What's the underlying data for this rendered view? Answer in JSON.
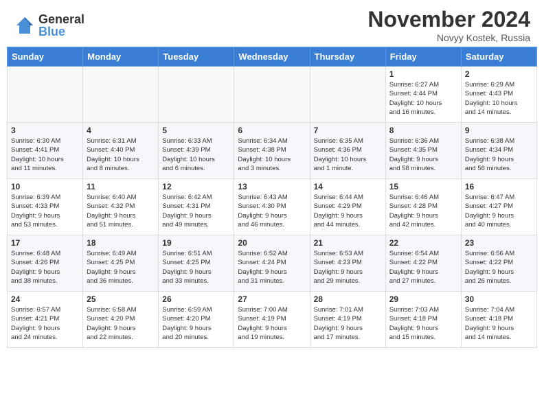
{
  "header": {
    "logo_general": "General",
    "logo_blue": "Blue",
    "month_title": "November 2024",
    "location": "Novyy Kostek, Russia"
  },
  "columns": [
    "Sunday",
    "Monday",
    "Tuesday",
    "Wednesday",
    "Thursday",
    "Friday",
    "Saturday"
  ],
  "weeks": [
    {
      "days": [
        {
          "num": "",
          "info": ""
        },
        {
          "num": "",
          "info": ""
        },
        {
          "num": "",
          "info": ""
        },
        {
          "num": "",
          "info": ""
        },
        {
          "num": "",
          "info": ""
        },
        {
          "num": "1",
          "info": "Sunrise: 6:27 AM\nSunset: 4:44 PM\nDaylight: 10 hours\nand 16 minutes."
        },
        {
          "num": "2",
          "info": "Sunrise: 6:29 AM\nSunset: 4:43 PM\nDaylight: 10 hours\nand 14 minutes."
        }
      ]
    },
    {
      "days": [
        {
          "num": "3",
          "info": "Sunrise: 6:30 AM\nSunset: 4:41 PM\nDaylight: 10 hours\nand 11 minutes."
        },
        {
          "num": "4",
          "info": "Sunrise: 6:31 AM\nSunset: 4:40 PM\nDaylight: 10 hours\nand 8 minutes."
        },
        {
          "num": "5",
          "info": "Sunrise: 6:33 AM\nSunset: 4:39 PM\nDaylight: 10 hours\nand 6 minutes."
        },
        {
          "num": "6",
          "info": "Sunrise: 6:34 AM\nSunset: 4:38 PM\nDaylight: 10 hours\nand 3 minutes."
        },
        {
          "num": "7",
          "info": "Sunrise: 6:35 AM\nSunset: 4:36 PM\nDaylight: 10 hours\nand 1 minute."
        },
        {
          "num": "8",
          "info": "Sunrise: 6:36 AM\nSunset: 4:35 PM\nDaylight: 9 hours\nand 58 minutes."
        },
        {
          "num": "9",
          "info": "Sunrise: 6:38 AM\nSunset: 4:34 PM\nDaylight: 9 hours\nand 56 minutes."
        }
      ]
    },
    {
      "days": [
        {
          "num": "10",
          "info": "Sunrise: 6:39 AM\nSunset: 4:33 PM\nDaylight: 9 hours\nand 53 minutes."
        },
        {
          "num": "11",
          "info": "Sunrise: 6:40 AM\nSunset: 4:32 PM\nDaylight: 9 hours\nand 51 minutes."
        },
        {
          "num": "12",
          "info": "Sunrise: 6:42 AM\nSunset: 4:31 PM\nDaylight: 9 hours\nand 49 minutes."
        },
        {
          "num": "13",
          "info": "Sunrise: 6:43 AM\nSunset: 4:30 PM\nDaylight: 9 hours\nand 46 minutes."
        },
        {
          "num": "14",
          "info": "Sunrise: 6:44 AM\nSunset: 4:29 PM\nDaylight: 9 hours\nand 44 minutes."
        },
        {
          "num": "15",
          "info": "Sunrise: 6:46 AM\nSunset: 4:28 PM\nDaylight: 9 hours\nand 42 minutes."
        },
        {
          "num": "16",
          "info": "Sunrise: 6:47 AM\nSunset: 4:27 PM\nDaylight: 9 hours\nand 40 minutes."
        }
      ]
    },
    {
      "days": [
        {
          "num": "17",
          "info": "Sunrise: 6:48 AM\nSunset: 4:26 PM\nDaylight: 9 hours\nand 38 minutes."
        },
        {
          "num": "18",
          "info": "Sunrise: 6:49 AM\nSunset: 4:25 PM\nDaylight: 9 hours\nand 36 minutes."
        },
        {
          "num": "19",
          "info": "Sunrise: 6:51 AM\nSunset: 4:25 PM\nDaylight: 9 hours\nand 33 minutes."
        },
        {
          "num": "20",
          "info": "Sunrise: 6:52 AM\nSunset: 4:24 PM\nDaylight: 9 hours\nand 31 minutes."
        },
        {
          "num": "21",
          "info": "Sunrise: 6:53 AM\nSunset: 4:23 PM\nDaylight: 9 hours\nand 29 minutes."
        },
        {
          "num": "22",
          "info": "Sunrise: 6:54 AM\nSunset: 4:22 PM\nDaylight: 9 hours\nand 27 minutes."
        },
        {
          "num": "23",
          "info": "Sunrise: 6:56 AM\nSunset: 4:22 PM\nDaylight: 9 hours\nand 26 minutes."
        }
      ]
    },
    {
      "days": [
        {
          "num": "24",
          "info": "Sunrise: 6:57 AM\nSunset: 4:21 PM\nDaylight: 9 hours\nand 24 minutes."
        },
        {
          "num": "25",
          "info": "Sunrise: 6:58 AM\nSunset: 4:20 PM\nDaylight: 9 hours\nand 22 minutes."
        },
        {
          "num": "26",
          "info": "Sunrise: 6:59 AM\nSunset: 4:20 PM\nDaylight: 9 hours\nand 20 minutes."
        },
        {
          "num": "27",
          "info": "Sunrise: 7:00 AM\nSunset: 4:19 PM\nDaylight: 9 hours\nand 19 minutes."
        },
        {
          "num": "28",
          "info": "Sunrise: 7:01 AM\nSunset: 4:19 PM\nDaylight: 9 hours\nand 17 minutes."
        },
        {
          "num": "29",
          "info": "Sunrise: 7:03 AM\nSunset: 4:18 PM\nDaylight: 9 hours\nand 15 minutes."
        },
        {
          "num": "30",
          "info": "Sunrise: 7:04 AM\nSunset: 4:18 PM\nDaylight: 9 hours\nand 14 minutes."
        }
      ]
    }
  ]
}
